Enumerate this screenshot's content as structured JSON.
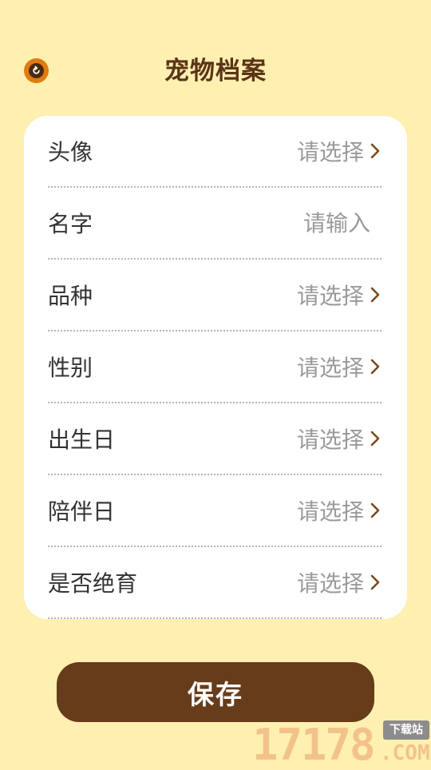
{
  "header": {
    "title": "宠物档案",
    "back_icon": "back-icon"
  },
  "form": {
    "rows": [
      {
        "label": "头像",
        "value": "请选择",
        "type": "select"
      },
      {
        "label": "名字",
        "placeholder": "请输入",
        "type": "input"
      },
      {
        "label": "品种",
        "value": "请选择",
        "type": "select"
      },
      {
        "label": "性别",
        "value": "请选择",
        "type": "select"
      },
      {
        "label": "出生日",
        "value": "请选择",
        "type": "select"
      },
      {
        "label": "陪伴日",
        "value": "请选择",
        "type": "select"
      },
      {
        "label": "是否绝育",
        "value": "请选择",
        "type": "select"
      }
    ]
  },
  "save_label": "保存",
  "watermark": {
    "digits": "17178",
    "com": ".COM",
    "tag": "下载站"
  },
  "colors": {
    "background": "#fdf0b0",
    "accent": "#663c1b",
    "title": "#5a3417",
    "back_button": "#e07b12",
    "chevron": "#7a4a1e"
  }
}
